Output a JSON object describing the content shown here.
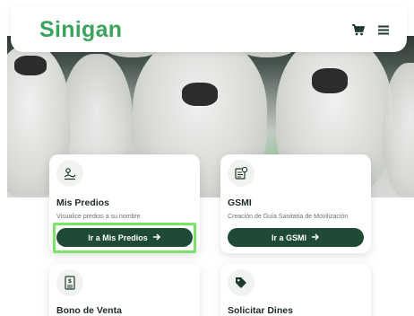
{
  "header": {
    "logo_text": "Sinigan",
    "cart_icon": "cart-icon",
    "menu_icon": "hamburger-menu-icon"
  },
  "colors": {
    "brand_green": "#3aa35c",
    "button_dark_green": "#1f4a35",
    "highlight": "#7be26a"
  },
  "cards": [
    {
      "icon": "land-plot-icon",
      "title": "Mis Predios",
      "description": "Visualice predios a su nombre",
      "button_label": "Ir a Mis Predios",
      "button_icon": "arrow-right-icon"
    },
    {
      "icon": "document-badge-icon",
      "title": "GSMI",
      "description": "Creación de Guía Sanitaria de Movilización",
      "button_label": "Ir a GSMI",
      "button_icon": "arrow-right-icon"
    },
    {
      "icon": "receipt-dollar-icon",
      "title": "Bono de Venta"
    },
    {
      "icon": "tag-icon",
      "title": "Solicitar Dines"
    }
  ]
}
